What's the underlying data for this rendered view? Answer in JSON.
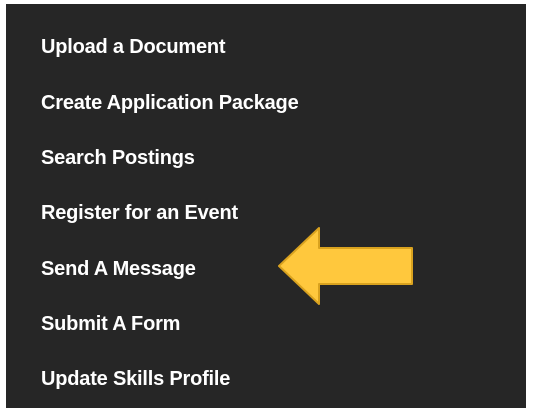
{
  "menu": {
    "items": [
      {
        "label": "Upload a Document"
      },
      {
        "label": "Create Application Package"
      },
      {
        "label": "Search Postings"
      },
      {
        "label": "Register for an Event"
      },
      {
        "label": "Send A Message"
      },
      {
        "label": "Submit A Form"
      },
      {
        "label": "Update Skills Profile"
      }
    ]
  },
  "annotation": {
    "icon": "arrow-left-icon",
    "fill_color": "#FFC83D",
    "stroke_color": "#D9A21F"
  },
  "colors": {
    "panel_background": "#262626",
    "menu_text": "#FFFFFF",
    "page_background": "#FFFFFF"
  }
}
